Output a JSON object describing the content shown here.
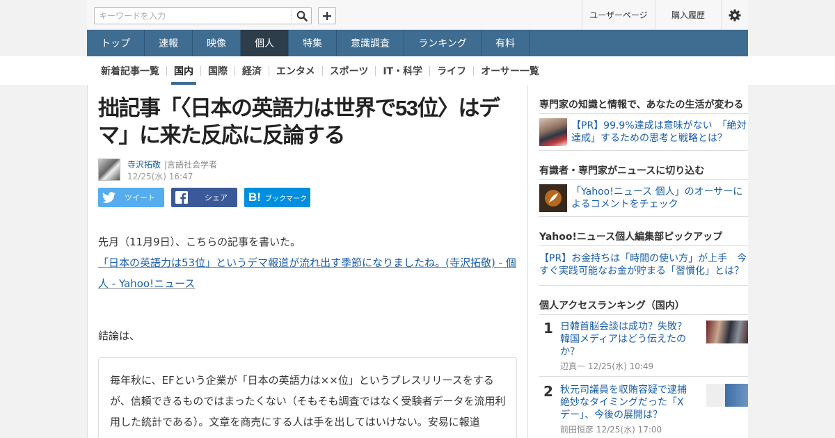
{
  "search": {
    "placeholder": "キーワードを入力"
  },
  "header": {
    "user_page": "ユーザーページ",
    "purchase_history": "購入履歴"
  },
  "nav": [
    "トップ",
    "速報",
    "映像",
    "個人",
    "特集",
    "意識調査",
    "ランキング",
    "有料"
  ],
  "nav_active": "個人",
  "subnav": [
    "新着記事一覧",
    "国内",
    "国際",
    "経済",
    "エンタメ",
    "スポーツ",
    "IT・科学",
    "ライフ",
    "オーサー一覧"
  ],
  "subnav_active": "国内",
  "article": {
    "title": "拙記事「〈日本の英語力は世界で53位〉はデマ」に来た反応に反論する",
    "author_name": "寺沢拓敬",
    "author_title": "|言語社会学者",
    "date": "12/25(水) 16:47",
    "share": {
      "tweet": "ツイート",
      "facebook": "シェア",
      "hatena": "ブックマーク"
    },
    "p1": "先月（11月9日）、こちらの記事を書いた。",
    "link1": "「日本の英語力は53位」というデマ報道が流れ出す季節になりましたね。(寺沢拓敬) - 個人 - Yahoo!ニュース",
    "p2": "結論は、",
    "quote": "毎年秋に、EFという企業が「日本の英語力は××位」というプレスリリースをするが、信頼できるものではまったくない（そもそも調査ではなく受験者データを流用利用した統計である）。文章を商売にする人は手を出してはいけない。安易に報道"
  },
  "sidebar": {
    "section1_title": "専門家の知識と情報で、あなたの生活が変わる",
    "section1_link": "【PR】99.9%達成は意味がない　「絶対達成」するための思考と戦略とは？",
    "section2_title": "有識者・専門家がニュースに切り込む",
    "section2_link": "「Yahoo!ニュース 個人」のオーサーによるコメントをチェック",
    "section3_title": "Yahoo!ニュース個人編集部ピックアップ",
    "section3_link": "【PR】お金持ちは「時間の使い方」が上手　今すぐ実践可能なお金が貯まる「習慣化」とは？",
    "ranking_title": "個人アクセスランキング（国内）",
    "ranking": [
      {
        "rank": "1",
        "title": "日韓首脳会談は成功？失敗？韓国メディアはどう伝えたのか？",
        "meta": "辺真一  12/25(水) 10:49"
      },
      {
        "rank": "2",
        "title": "秋元司議員を収賄容疑で逮捕　絶妙なタイミングだった「Xデー」、今後の展開は？",
        "meta": "前田恒彦  12/25(水) 17:00"
      }
    ]
  },
  "colors": {
    "nav_bg": "#3f6c91",
    "nav_active": "#2e3d4a",
    "link": "#1b5fa7",
    "twitter": "#55acee",
    "facebook": "#3b5998",
    "hatena": "#008fde"
  }
}
